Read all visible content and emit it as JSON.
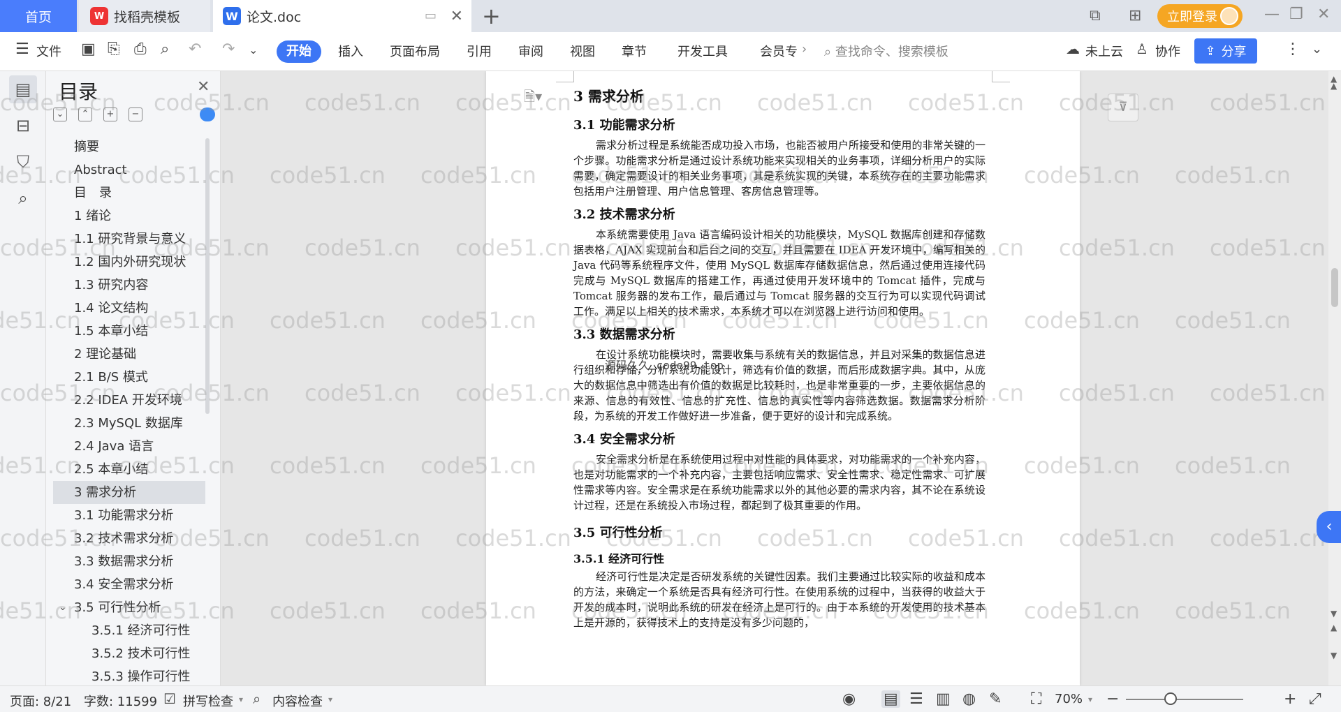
{
  "tabs": {
    "home": "首页",
    "template": "找稻壳模板",
    "doc": "论文.doc"
  },
  "login": "立即登录",
  "ribbon": {
    "file": "文件",
    "start": "开始",
    "insert": "插入",
    "layout": "页面布局",
    "reference": "引用",
    "review": "审阅",
    "view": "视图",
    "chapter": "章节",
    "devtools": "开发工具",
    "member": "会员专",
    "search_placeholder": "查找命令、搜索模板",
    "cloud": "未上云",
    "collab": "协作",
    "share": "分享"
  },
  "toc": {
    "title": "目录",
    "items": [
      {
        "label": "摘要",
        "level": 1
      },
      {
        "label": "Abstract",
        "level": 1
      },
      {
        "label": "目　录",
        "level": 1
      },
      {
        "label": "1 绪论",
        "level": 1
      },
      {
        "label": "1.1 研究背景与意义",
        "level": 2
      },
      {
        "label": "1.2 国内外研究现状",
        "level": 2
      },
      {
        "label": "1.3 研究内容",
        "level": 2
      },
      {
        "label": "1.4 论文结构",
        "level": 2
      },
      {
        "label": "1.5 本章小结",
        "level": 2
      },
      {
        "label": "2 理论基础",
        "level": 1
      },
      {
        "label": "2.1 B/S 模式",
        "level": 2
      },
      {
        "label": "2.2 IDEA 开发环境",
        "level": 2
      },
      {
        "label": "2.3 MySQL 数据库",
        "level": 2
      },
      {
        "label": "2.4 Java 语言",
        "level": 2
      },
      {
        "label": "2.5 本章小结",
        "level": 2
      },
      {
        "label": "3 需求分析",
        "level": 1,
        "selected": true
      },
      {
        "label": "3.1 功能需求分析",
        "level": 2
      },
      {
        "label": "3.2 技术需求分析",
        "level": 2
      },
      {
        "label": "3.3 数据需求分析",
        "level": 2
      },
      {
        "label": "3.4 安全需求分析",
        "level": 2
      },
      {
        "label": "3.5 可行性分析",
        "level": 2,
        "expanded": true
      },
      {
        "label": "3.5.1 经济可行性",
        "level": 3
      },
      {
        "label": "3.5.2 技术可行性",
        "level": 3
      },
      {
        "label": "3.5.3 操作可行性",
        "level": 3
      }
    ]
  },
  "doc": {
    "h1": "3 需求分析",
    "s31_title": "3.1 功能需求分析",
    "s31_body": "需求分析过程是系统能否成功投入市场，也能否被用户所接受和使用的非常关键的一个步骤。功能需求分析是通过设计系统功能来实现相关的业务事项，详细分析用户的实际需要，确定需要设计的相关业务事项，其是系统实现的关键，本系统存在的主要功能需求包括用户注册管理、用户信息管理、客房信息管理等。",
    "s32_title": "3.2 技术需求分析",
    "s32_body": "本系统需要使用 Java 语言编码设计相关的功能模块，MySQL 数据库创建和存储数据表格，AJAX 实现前台和后台之间的交互，并且需要在 IDEA 开发环境中，编写相关的 Java 代码等系统程序文件，使用 MySQL 数据库存储数据信息，然后通过使用连接代码完成与 MySQL 数据库的搭建工作，再通过使用开发环境中的 Tomcat 插件，完成与 Tomcat 服务器的发布工作，最后通过与 Tomcat 服务器的交互行为可以实现代码调试工作。满足以上相关的技术需求，本系统才可以在浏览器上进行访问和使用。",
    "s33_title": "3.3 数据需求分析",
    "s33_body": "在设计系统功能模块时，需要收集与系统有关的数据信息，并且对采集的数据信息进行组织和存储，分析系统功能设计，筛选有价值的数据，而后形成数据字典。其中，从庞大的数据信息中筛选出有价值的数据是比较耗时，也是非常重要的一步，主要依据信息的来源、信息的有效性、信息的扩充性、信息的真实性等内容筛选数据。数据需求分析阶段，为系统的开发工作做好进一步准备，便于更好的设计和完成系统。",
    "s34_title": "3.4 安全需求分析",
    "s34_body": "安全需求分析是在系统使用过程中对性能的具体要求，对功能需求的一个补充内容，也是对功能需求的一个补充内容，主要包括响应需求、安全性需求、稳定性需求、可扩展性需求等内容。安全需求是在系统功能需求以外的其他必要的需求内容，其不论在系统设计过程，还是在系统投入市场过程，都起到了极其重要的作用。",
    "s35_title": "3.5 可行性分析",
    "s351_title": "3.5.1 经济可行性",
    "s351_body": "经济可行性是决定是否研发系统的关键性因素。我们主要通过比较实际的收益和成本的方法，来确定一个系统是否具有经济可行性。在使用系统的过程中，当获得的收益大于开发的成本时，说明此系统的研发在经济上是可行的。由于本系统的开发使用的技术基本上是开源的，获得技术上的支持是没有多少问题的，",
    "overlay_text": "源码久久 code99.top"
  },
  "watermark": "code51.cn",
  "status": {
    "page": "页面: 8/21",
    "words": "字数: 11599",
    "spell": "拼写检查",
    "content": "内容检查",
    "zoom": "70%",
    "zoom_fraction": 0.38
  }
}
